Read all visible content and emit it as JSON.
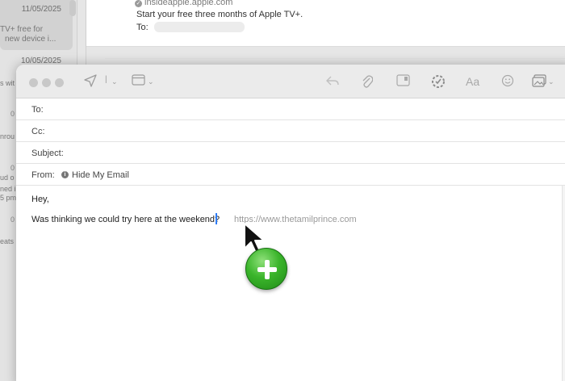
{
  "background_app": {
    "message_list": {
      "row1": {
        "date": "11/05/2025",
        "snippet_line1": "TV+ free for",
        "snippet_line2": "new device i..."
      },
      "row2": {
        "date": "10/05/2025"
      },
      "fragments": [
        "s wit",
        "nrou",
        "ud o",
        "ned i",
        "5 pm",
        "eats"
      ],
      "numbers": [
        "0",
        "0",
        "0",
        "0"
      ]
    },
    "preview": {
      "sender": "insideapple.apple.com",
      "subject": "Start your free three months of Apple TV+.",
      "to_label": "To:"
    }
  },
  "compose": {
    "toolbar": {
      "icons": [
        "send-icon",
        "chevron-down-icon",
        "header-fields-icon",
        "chevron-down-icon",
        "reply-icon",
        "attachment-icon",
        "annotate-icon",
        "badge-icon",
        "font-icon",
        "emoji-icon",
        "photo-browser-icon",
        "chevron-down-icon"
      ]
    },
    "fields": {
      "to_label": "To:",
      "cc_label": "Cc:",
      "subject_label": "Subject:",
      "from_label": "From:",
      "from_value": "Hide My Email",
      "to_value": "",
      "cc_value": "",
      "subject_value": ""
    },
    "body": {
      "greeting": "Hey,",
      "line": "Was thinking we could try here at the weekend?"
    },
    "drag": {
      "url": "https://www.thetamilprince.com",
      "badge": "+"
    }
  },
  "colors": {
    "caret": "#2e7cf6",
    "copy_badge": "#3bb52b"
  }
}
